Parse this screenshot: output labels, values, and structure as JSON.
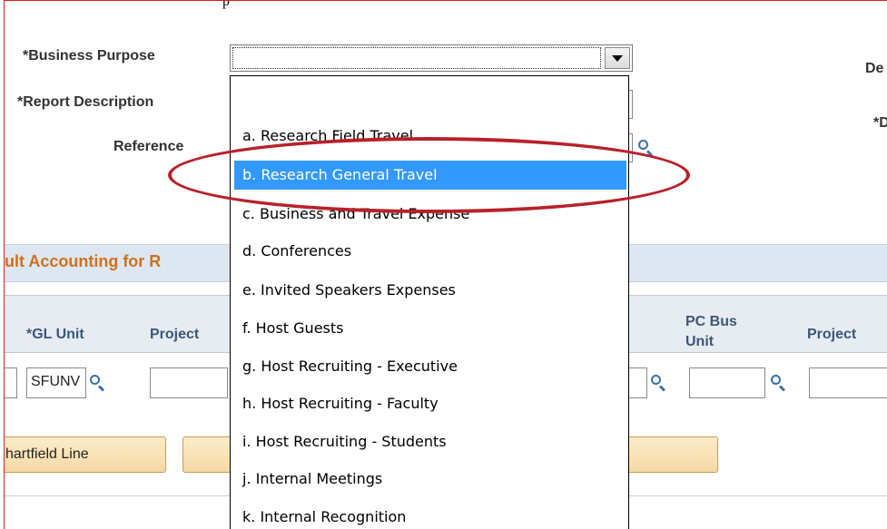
{
  "header": {
    "caption": "p",
    "business_purpose_label": "*Business Purpose",
    "report_description_label": "*Report Description",
    "reference_label": "Reference",
    "right_label_1": "De",
    "right_label_2": "*D"
  },
  "business_purpose": {
    "value": "",
    "options": [
      "",
      "a. Research Field Travel",
      "b. Research General Travel",
      "c. Business and Travel Expense",
      "d. Conferences",
      "e. Invited Speakers Expenses",
      "f. Host Guests",
      "g. Host Recruiting - Executive",
      "h. Host Recruiting - Faculty",
      "i. Host Recruiting - Students",
      "j. Internal Meetings",
      "k. Internal Recognition"
    ],
    "highlighted_option": "b. Research General Travel"
  },
  "accounting": {
    "section_title": "ult Accounting for R",
    "columns": {
      "gl_unit": "*GL Unit",
      "project": "Project",
      "pc_bus_unit_line1": "PC Bus",
      "pc_bus_unit_line2": "Unit",
      "project_right": "Project"
    },
    "row": {
      "gl_unit_value": "SFUNV",
      "project_value": "",
      "pc_bus_unit_value": "",
      "project_right_value": ""
    },
    "buttons": {
      "chartfield_line": "hartfield Line"
    }
  },
  "colors": {
    "highlight": "#3399ff",
    "annotation": "#b8212a",
    "section_title": "#d0701a",
    "frame": "#e02020"
  }
}
